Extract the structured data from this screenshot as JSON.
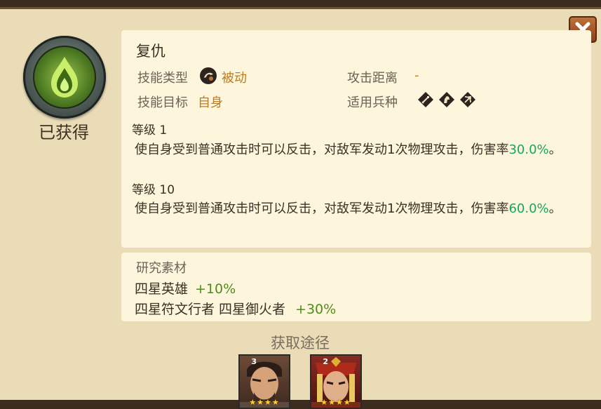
{
  "skill": {
    "name": "复仇",
    "status": "已获得",
    "type_label": "技能类型",
    "type_value": "被动",
    "target_label": "技能目标",
    "target_value": "自身",
    "range_label": "攻击距离",
    "range_value": "-",
    "troops_label": "适用兵种",
    "troop_icons": [
      "infantry-icon",
      "cavalry-icon",
      "archer-icon"
    ],
    "levels": [
      {
        "label": "等级 1",
        "desc_main": "使自身受到普通攻击时可以反击，对敌军发动1次物理攻击，伤害率",
        "desc_value": "30.0%",
        "desc_end": "。"
      },
      {
        "label": "等级 10",
        "desc_main": "使自身受到普通攻击时可以反击，对敌军发动1次物理攻击，伤害率",
        "desc_value": "60.0%",
        "desc_end": "。"
      }
    ]
  },
  "materials": {
    "title": "研究素材",
    "rows": [
      {
        "text": "四星英雄",
        "bonus": "+10%"
      },
      {
        "text": "四星符文行者 四星御火者",
        "bonus": "+30%"
      }
    ]
  },
  "source": {
    "title": "获取途径",
    "heroes": [
      {
        "badge": "3",
        "stars": "★★★★"
      },
      {
        "badge": "2",
        "stars": "★★★★"
      }
    ]
  },
  "colors": {
    "accent_orange": "#c07a1c",
    "value_green": "#1aa65a",
    "bonus_green": "#4f8c1a"
  }
}
